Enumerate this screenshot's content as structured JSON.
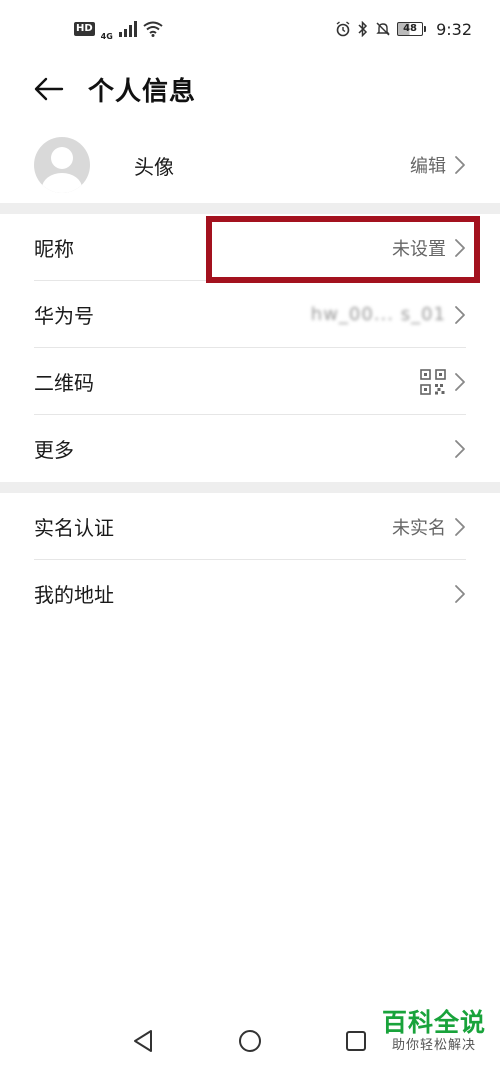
{
  "status_bar": {
    "hd_label": "HD",
    "network_label": "4G",
    "battery_level": "48",
    "time": "9:32"
  },
  "header": {
    "title": "个人信息",
    "back_icon": "arrow-left-icon"
  },
  "avatar_row": {
    "label": "头像",
    "action": "编辑"
  },
  "rows": [
    {
      "label": "昵称",
      "value": "未设置"
    },
    {
      "label": "华为号",
      "value": "hw_00... s_01"
    },
    {
      "label": "二维码",
      "value": ""
    },
    {
      "label": "更多",
      "value": ""
    },
    {
      "label": "实名认证",
      "value": "未实名"
    },
    {
      "label": "我的地址",
      "value": ""
    }
  ],
  "colors": {
    "highlight": "#a3111e",
    "watermark": "#19a33b",
    "section_gap": "#eeeeee"
  },
  "watermark": {
    "title": "百科全说",
    "subtitle": "助你轻松解决"
  }
}
